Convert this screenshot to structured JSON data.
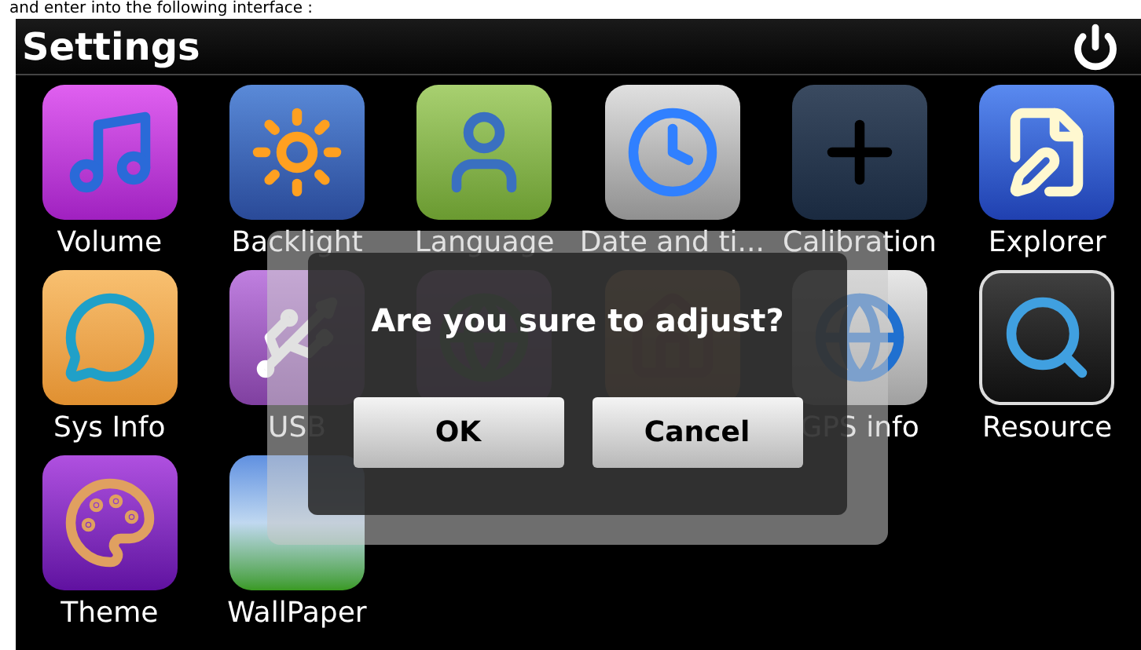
{
  "caption": "and enter into the following interface :",
  "header": {
    "title": "Settings"
  },
  "apps": [
    {
      "label": "Volume",
      "kind": "volume"
    },
    {
      "label": "Backlight",
      "kind": "backlight"
    },
    {
      "label": "Language",
      "kind": "language"
    },
    {
      "label": "Date and ti...",
      "kind": "clock"
    },
    {
      "label": "Calibration",
      "kind": "calibration"
    },
    {
      "label": "Explorer",
      "kind": "explorer"
    },
    {
      "label": "Sys Info",
      "kind": "sysinfo"
    },
    {
      "label": "USB",
      "kind": "usb"
    },
    {
      "kind": "navpath"
    },
    {
      "kind": "default"
    },
    {
      "label": "GPS info",
      "kind": "gps"
    },
    {
      "label": "Resource",
      "kind": "resource"
    },
    {
      "label": "Theme",
      "kind": "theme"
    },
    {
      "label": "WallPaper",
      "kind": "wallpaper"
    }
  ],
  "dialog": {
    "message": "Are you sure to adjust?",
    "buttons": [
      "OK",
      "Cancel"
    ]
  }
}
